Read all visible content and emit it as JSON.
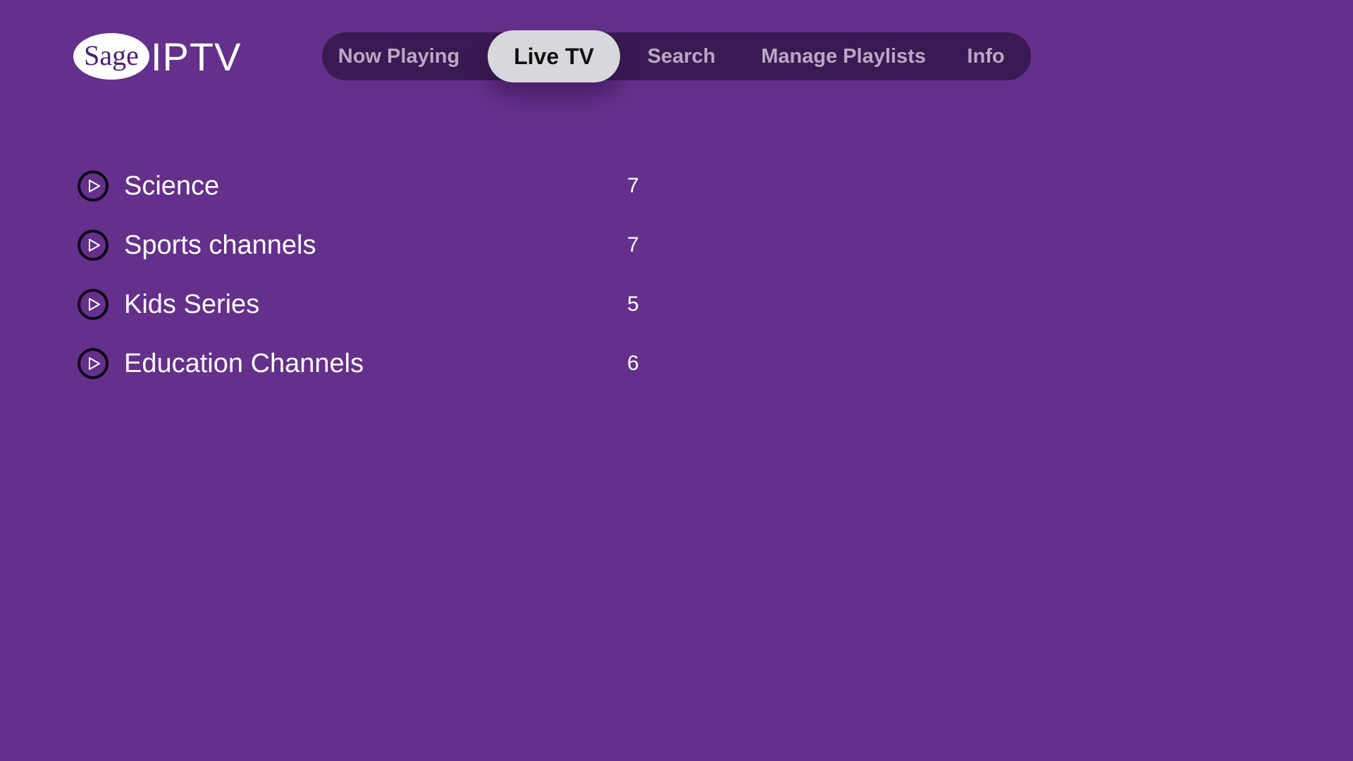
{
  "app": {
    "logo_mark": "Sage",
    "logo_text": "IPTV"
  },
  "nav": {
    "items": [
      {
        "label": "Now Playing",
        "active": false
      },
      {
        "label": "Live TV",
        "active": true
      },
      {
        "label": "Search",
        "active": false
      },
      {
        "label": "Manage Playlists",
        "active": false
      },
      {
        "label": "Info",
        "active": false
      }
    ]
  },
  "categories": [
    {
      "name": "Science",
      "count": "7",
      "icon": "play-circle-icon"
    },
    {
      "name": "Sports channels",
      "count": "7",
      "icon": "play-circle-icon"
    },
    {
      "name": "Kids Series",
      "count": "5",
      "icon": "play-circle-icon"
    },
    {
      "name": "Education Channels",
      "count": "6",
      "icon": "play-circle-icon"
    }
  ],
  "colors": {
    "background": "#64308b",
    "nav_background": "#3a1a52",
    "active_tab": "#d8d8dc",
    "inactive_tab_text": "#b9a9c6",
    "icon_stroke": "#0d0416"
  }
}
